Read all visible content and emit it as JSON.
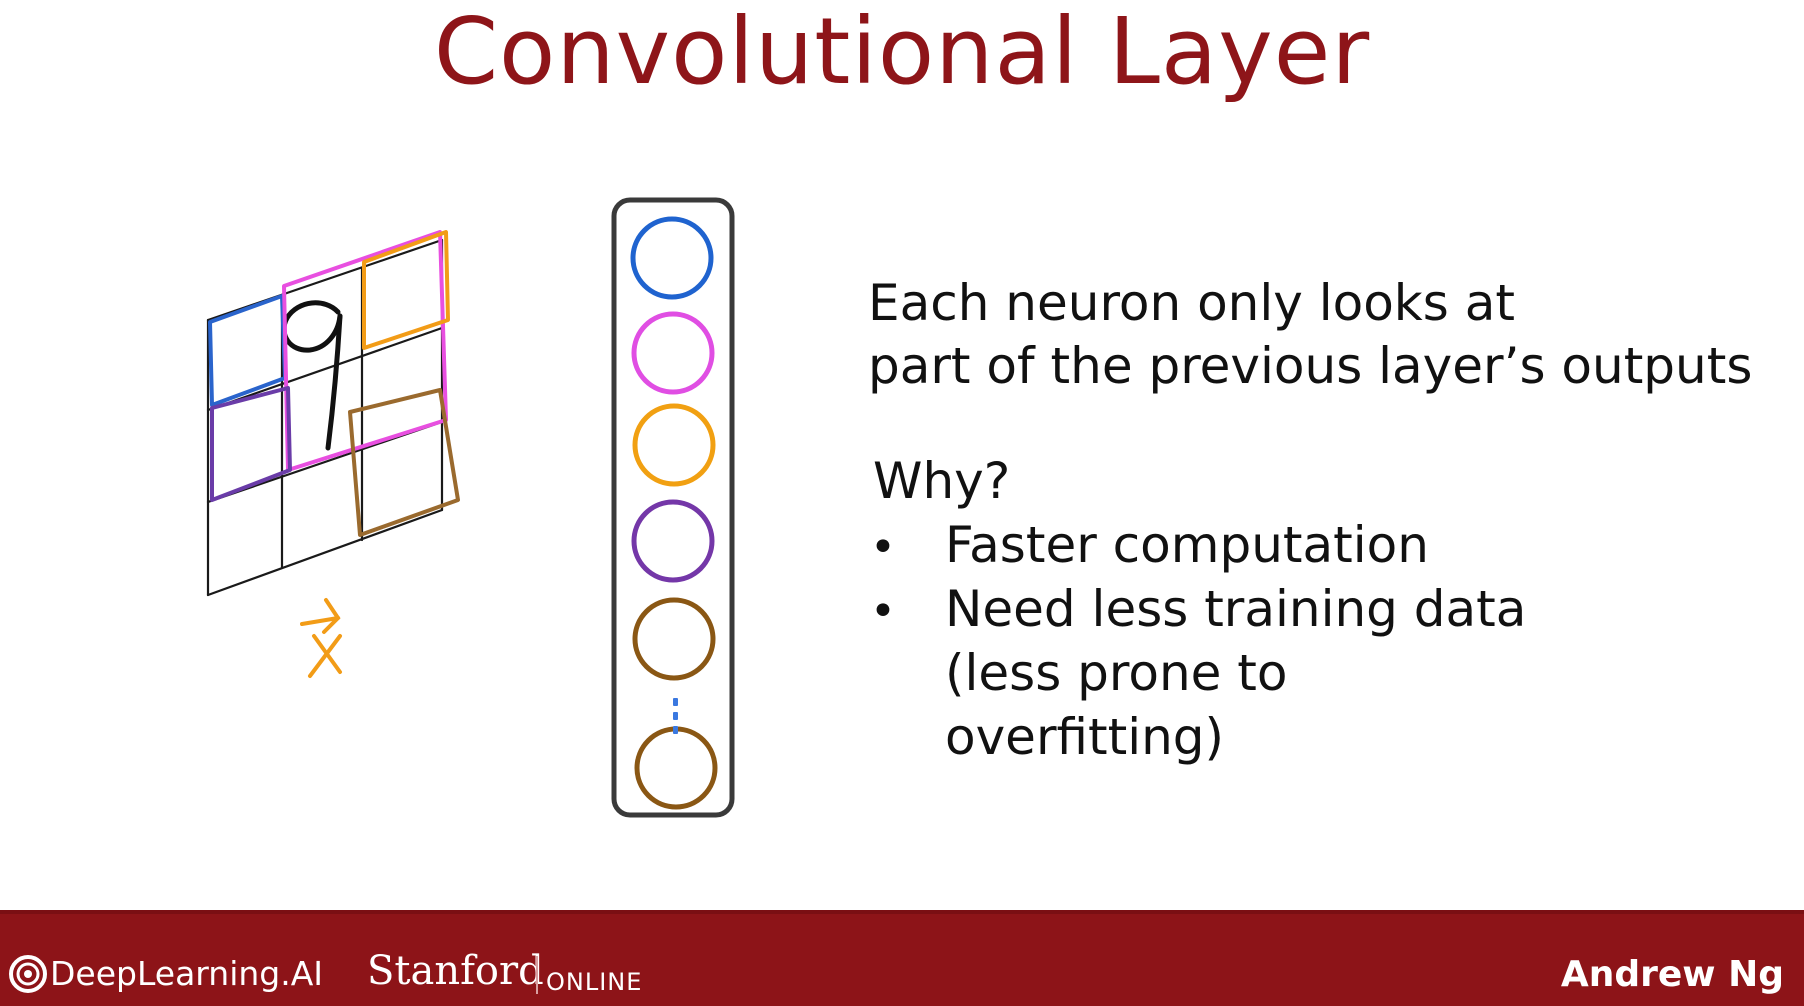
{
  "slide": {
    "title": "Convolutional Layer",
    "title_color": "#8e1519",
    "description_lines": [
      "Each neuron only looks at",
      "part of the previous layer’s outputs"
    ],
    "why_label": "Why?",
    "bullets": [
      "Faster computation",
      "Need less training data"
    ],
    "bullet_continuation": [
      "(less prone to",
      "overfitting)"
    ],
    "bullet_symbol": "•"
  },
  "figure": {
    "input_label": "x⃗",
    "handwritten_digit": "9",
    "region_colors": [
      "#2a64cc",
      "#e84fe0",
      "#f29c17",
      "#6a3ca8",
      "#9a6a2e"
    ],
    "neuron_colors": [
      "#1f63cf",
      "#e04ee3",
      "#f1a012",
      "#7437a8",
      "#8a5714",
      "#8a5714"
    ],
    "ellipsis_color": "#3a78e0",
    "input_label_color": "#f29c17"
  },
  "footer": {
    "background_color": "#8d1418",
    "brand": "DeepLearning.AI",
    "partner": "Stanford",
    "partner_suffix": "ONLINE",
    "author": "Andrew Ng"
  }
}
